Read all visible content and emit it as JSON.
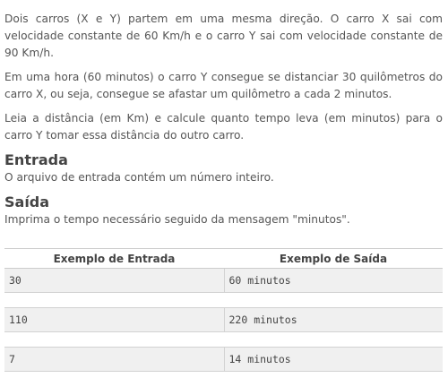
{
  "description": {
    "paragraphs": [
      "Dois carros (X e Y) partem em uma mesma direção. O carro X sai com velocidade constante de 60 Km/h e o carro Y sai com velocidade constante de 90 Km/h.",
      "Em uma hora (60 minutos) o carro Y consegue se distanciar 30 quilômetros do carro X, ou seja, consegue se afastar um quilômetro a cada 2 minutos.",
      "Leia a distância (em Km) e calcule quanto tempo leva (em minutos) para o carro Y tomar essa distância do outro carro."
    ]
  },
  "input_section": {
    "title": "Entrada",
    "text": "O arquivo de entrada contém um número inteiro."
  },
  "output_section": {
    "title": "Saída",
    "text": "Imprima o tempo necessário seguido da mensagem \"minutos\"."
  },
  "examples": {
    "headers": [
      "Exemplo de Entrada",
      "Exemplo de Saída"
    ],
    "rows": [
      {
        "input": "30",
        "output": "60 minutos"
      },
      {
        "input": "110",
        "output": "220 minutos"
      },
      {
        "input": "7",
        "output": "14 minutos"
      }
    ]
  },
  "colors": {
    "text": "#555555",
    "heading": "#444444",
    "cell_background": "#f0f0f0",
    "border": "#cccccc"
  }
}
